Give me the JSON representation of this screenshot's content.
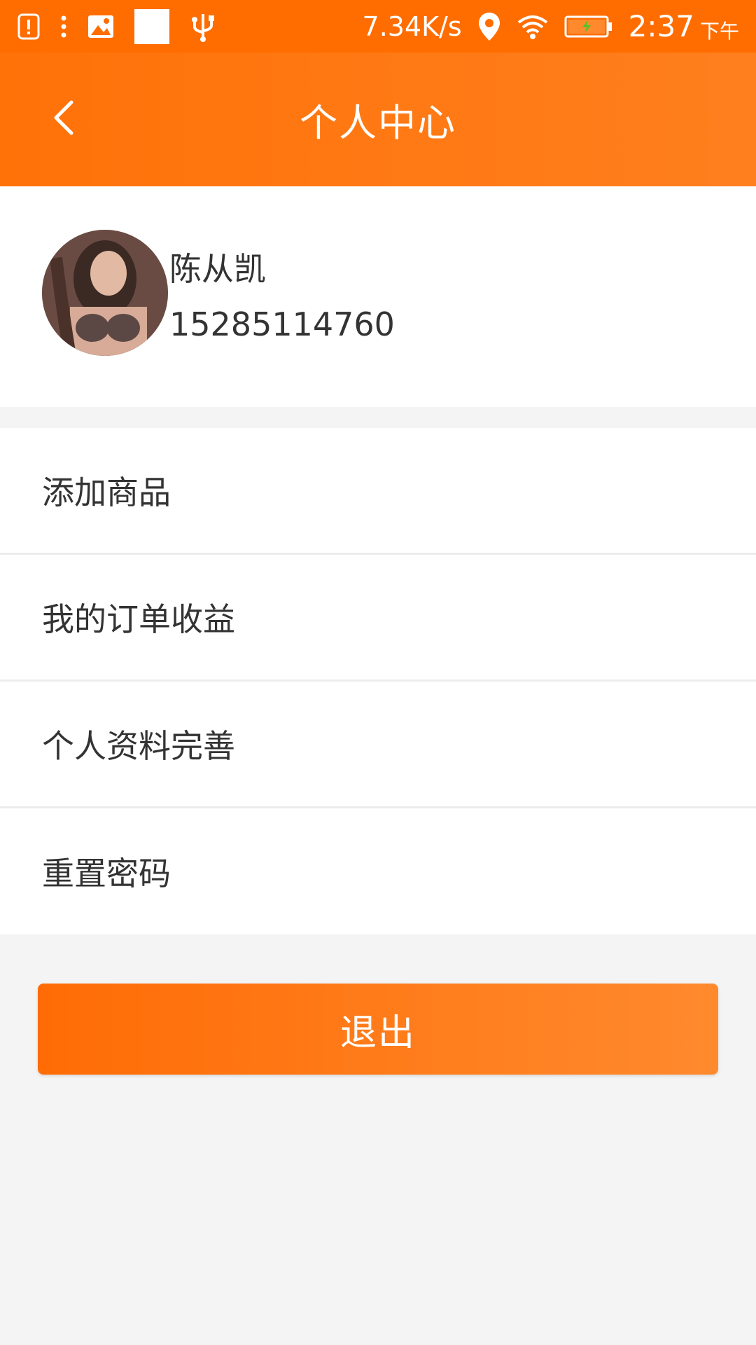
{
  "status_bar": {
    "net_speed": "7.34K/s",
    "time": "2:37",
    "ampm": "下午",
    "icons": [
      "notification-alert-icon",
      "more-dots-icon",
      "image-icon",
      "white-square",
      "usb-icon",
      "location-icon",
      "wifi-icon",
      "battery-icon"
    ]
  },
  "header": {
    "title": "个人中心",
    "back_icon": "chevron-left-icon"
  },
  "profile": {
    "name": "陈从凯",
    "phone": "15285114760"
  },
  "menu": {
    "items": [
      {
        "label": "添加商品"
      },
      {
        "label": "我的订单收益"
      },
      {
        "label": "个人资料完善"
      },
      {
        "label": "重置密码"
      }
    ]
  },
  "logout": {
    "label": "退出"
  },
  "colors": {
    "accent": "#ff6d00",
    "background": "#f4f4f4"
  }
}
